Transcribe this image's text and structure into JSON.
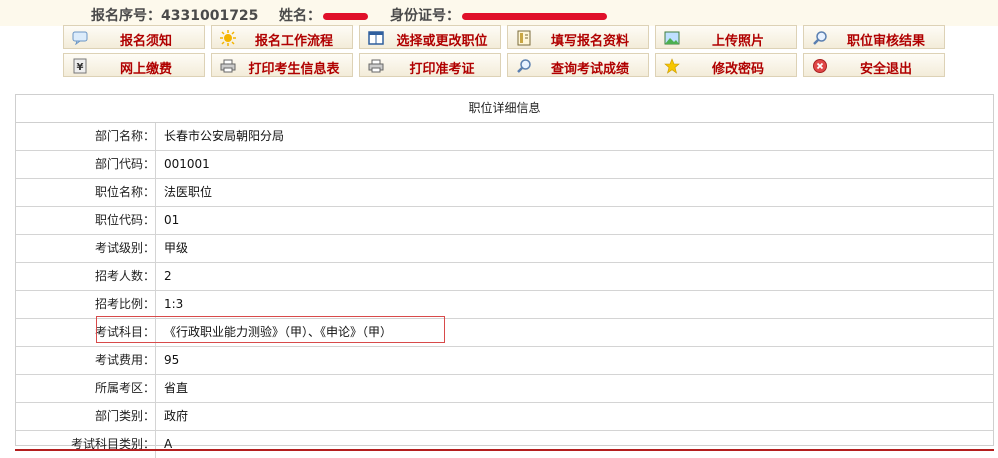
{
  "header": {
    "reg_no_label": "报名序号：",
    "reg_no_value": "4331001725",
    "name_label": "姓名：",
    "id_label": "身份证号："
  },
  "toolbar": {
    "buttons": [
      {
        "label": "报名须知",
        "icon": "notice-icon"
      },
      {
        "label": "报名工作流程",
        "icon": "sun-icon"
      },
      {
        "label": "选择或更改职位",
        "icon": "window-icon"
      },
      {
        "label": "填写报名资料",
        "icon": "form-icon"
      },
      {
        "label": "上传照片",
        "icon": "photo-icon"
      },
      {
        "label": "职位审核结果",
        "icon": "search-icon"
      },
      {
        "label": "网上缴费",
        "icon": "yen-icon"
      },
      {
        "label": "打印考生信息表",
        "icon": "printer-icon"
      },
      {
        "label": "打印准考证",
        "icon": "printer-icon"
      },
      {
        "label": "查询考试成绩",
        "icon": "search-icon"
      },
      {
        "label": "修改密码",
        "icon": "star-icon"
      },
      {
        "label": "安全退出",
        "icon": "exit-icon"
      }
    ]
  },
  "detail": {
    "title": "职位详细信息",
    "rows": [
      {
        "label": "部门名称：",
        "value": "长春市公安局朝阳分局"
      },
      {
        "label": "部门代码：",
        "value": "001001"
      },
      {
        "label": "职位名称：",
        "value": "法医职位"
      },
      {
        "label": "职位代码：",
        "value": "01"
      },
      {
        "label": "考试级别：",
        "value": "甲级"
      },
      {
        "label": "招考人数：",
        "value": "2"
      },
      {
        "label": "招考比例：",
        "value": "1:3"
      },
      {
        "label": "考试科目：",
        "value": "《行政职业能力测验》（甲）、《申论》（甲）"
      },
      {
        "label": "考试费用：",
        "value": "95"
      },
      {
        "label": "所属考区：",
        "value": "省直"
      },
      {
        "label": "部门类别：",
        "value": "政府"
      },
      {
        "label": "考试科目类别：",
        "value": "A"
      }
    ]
  },
  "colors": {
    "button_text": "#b00000",
    "header_bg": "#fdf9ec",
    "highlight_border": "#d84a4a",
    "redaction": "#e0102a"
  }
}
